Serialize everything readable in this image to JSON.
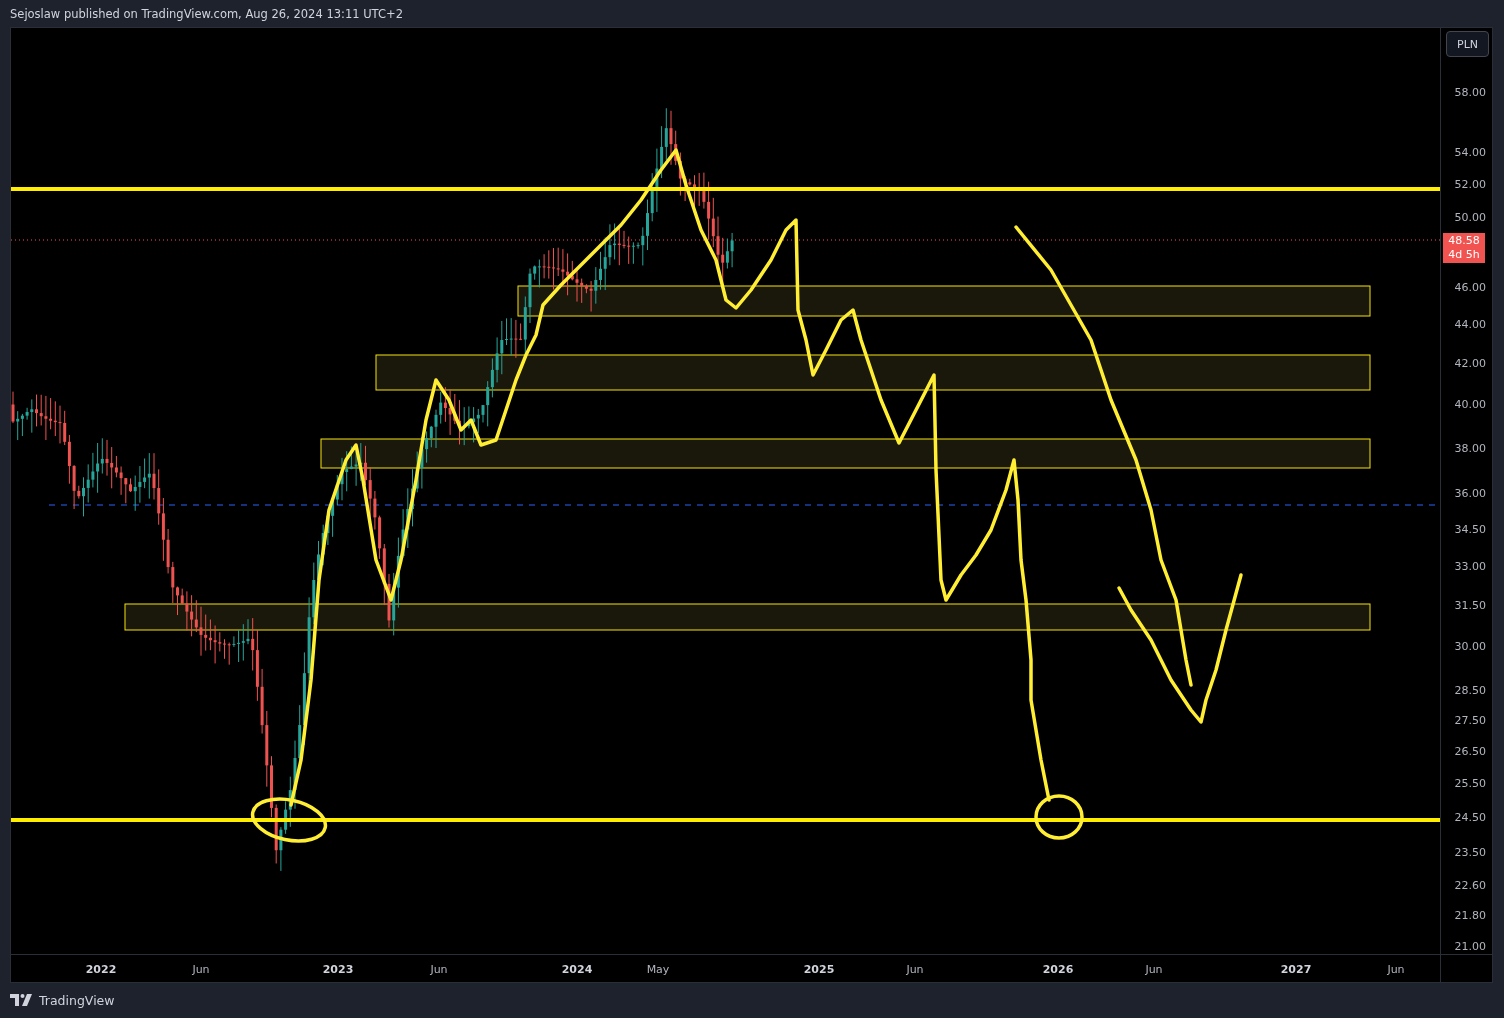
{
  "header": {
    "text": "Sejoslaw published on TradingView.com, Aug 26, 2024 13:11 UTC+2"
  },
  "currency_button": {
    "label": "PLN"
  },
  "price_axis": {
    "labels": [
      "58.00",
      "54.00",
      "52.00",
      "50.00",
      "46.00",
      "44.00",
      "42.00",
      "40.00",
      "38.00",
      "36.00",
      "34.50",
      "33.00",
      "31.50",
      "30.00",
      "28.50",
      "27.50",
      "26.50",
      "25.50",
      "24.50",
      "23.50",
      "22.60",
      "21.80",
      "21.00"
    ]
  },
  "price_tag": {
    "price": "48.58",
    "countdown": "4d 5h"
  },
  "time_axis": {
    "labels": [
      {
        "text": "2022",
        "kind": "year"
      },
      {
        "text": "Jun",
        "kind": "month"
      },
      {
        "text": "2023",
        "kind": "year"
      },
      {
        "text": "Jun",
        "kind": "month"
      },
      {
        "text": "2024",
        "kind": "year"
      },
      {
        "text": "May",
        "kind": "month"
      },
      {
        "text": "2025",
        "kind": "year"
      },
      {
        "text": "Jun",
        "kind": "month"
      },
      {
        "text": "2026",
        "kind": "year"
      },
      {
        "text": "Jun",
        "kind": "month"
      },
      {
        "text": "2027",
        "kind": "year"
      },
      {
        "text": "Jun",
        "kind": "month"
      }
    ]
  },
  "footer": {
    "brand": "TradingView"
  }
}
